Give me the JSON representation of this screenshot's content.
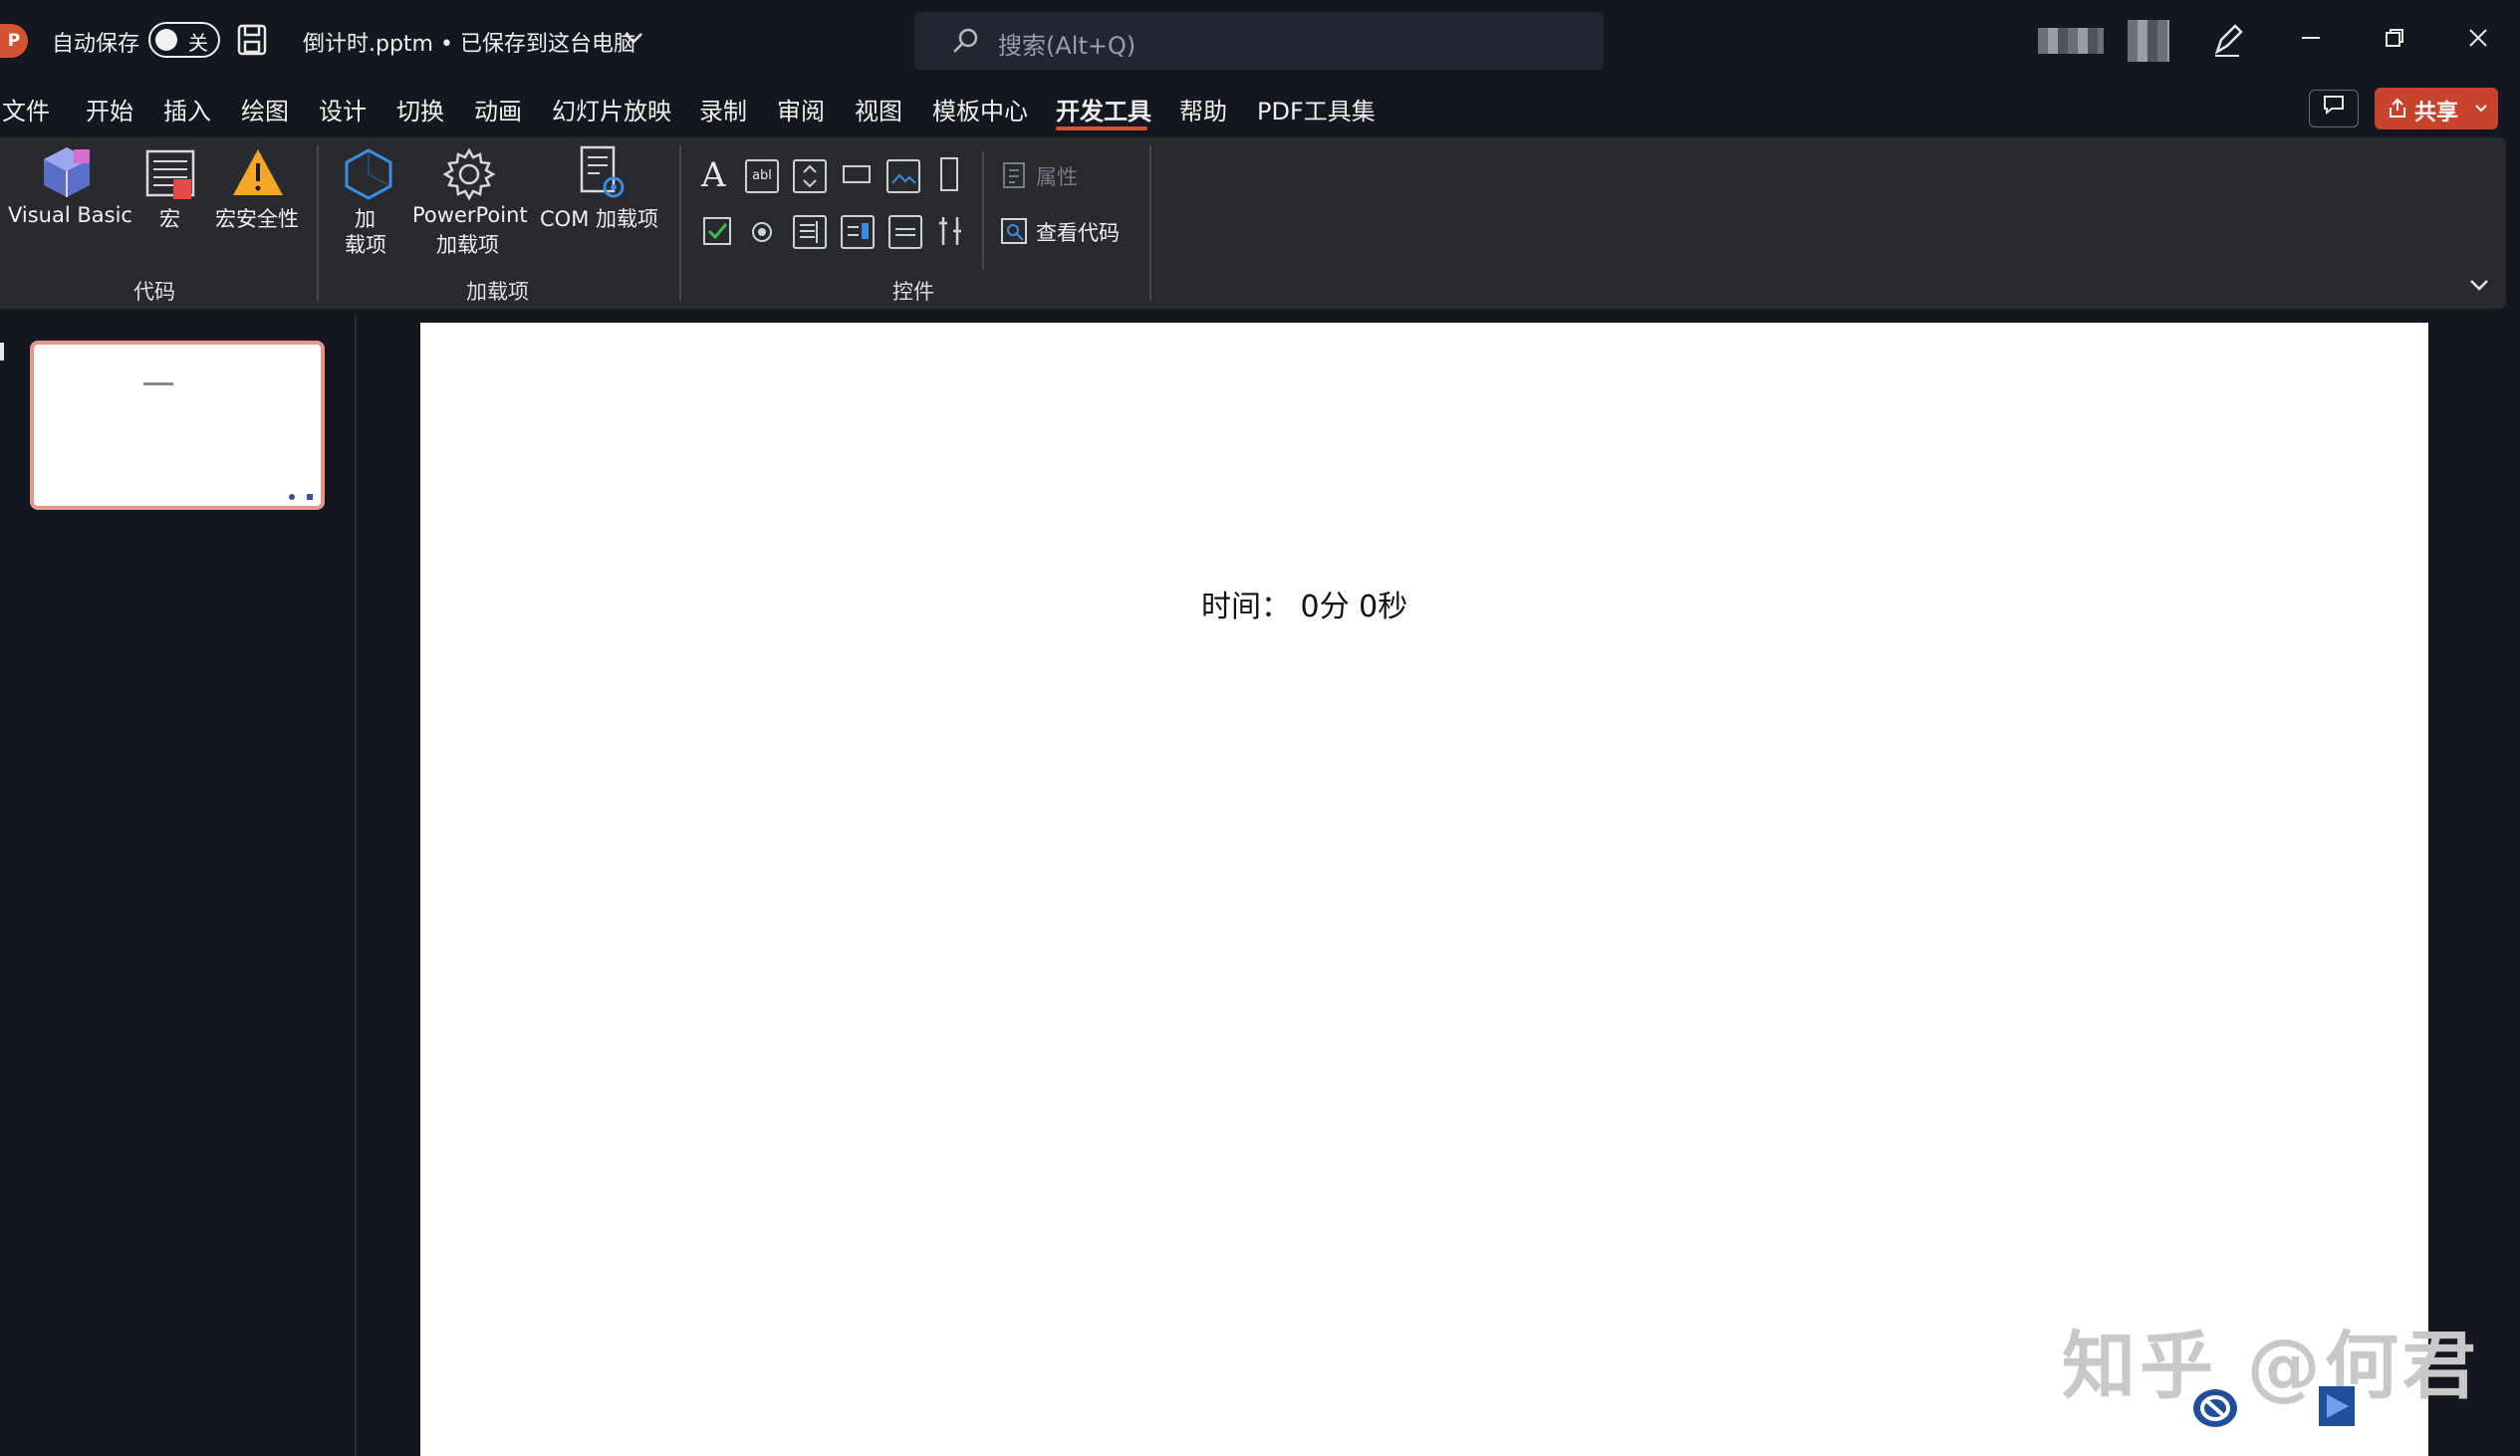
{
  "titlebar": {
    "autosave_label": "自动保存",
    "autosave_state": "关",
    "filename": "倒计时.pptm • 已保存到这台电脑",
    "search_placeholder": "搜索(Alt+Q)"
  },
  "menu": {
    "items": [
      "文件",
      "开始",
      "插入",
      "绘图",
      "设计",
      "切换",
      "动画",
      "幻灯片放映",
      "录制",
      "审阅",
      "视图",
      "模板中心",
      "开发工具",
      "帮助",
      "PDF工具集"
    ],
    "active": "开发工具",
    "share_label": "共享"
  },
  "ribbon": {
    "code": {
      "label": "代码",
      "visual_basic": "Visual Basic",
      "macro": "宏",
      "macro_security": "宏安全性"
    },
    "addins": {
      "label": "加载项",
      "addin_line1": "加",
      "addin_line2": "载项",
      "ppt_line1": "PowerPoint",
      "ppt_line2": "加载项",
      "com_addin": "COM 加载项"
    },
    "controls": {
      "label": "控件",
      "properties": "属性",
      "view_code": "查看代码",
      "label_glyph": "A",
      "textbox_glyph": "abl"
    }
  },
  "slide": {
    "time_text": "时间：  0分 0秒",
    "watermark": "知乎 @何君"
  },
  "colors": {
    "accent": "#d35230",
    "ribbon_bg": "#282a30",
    "window_bg": "#141720"
  }
}
